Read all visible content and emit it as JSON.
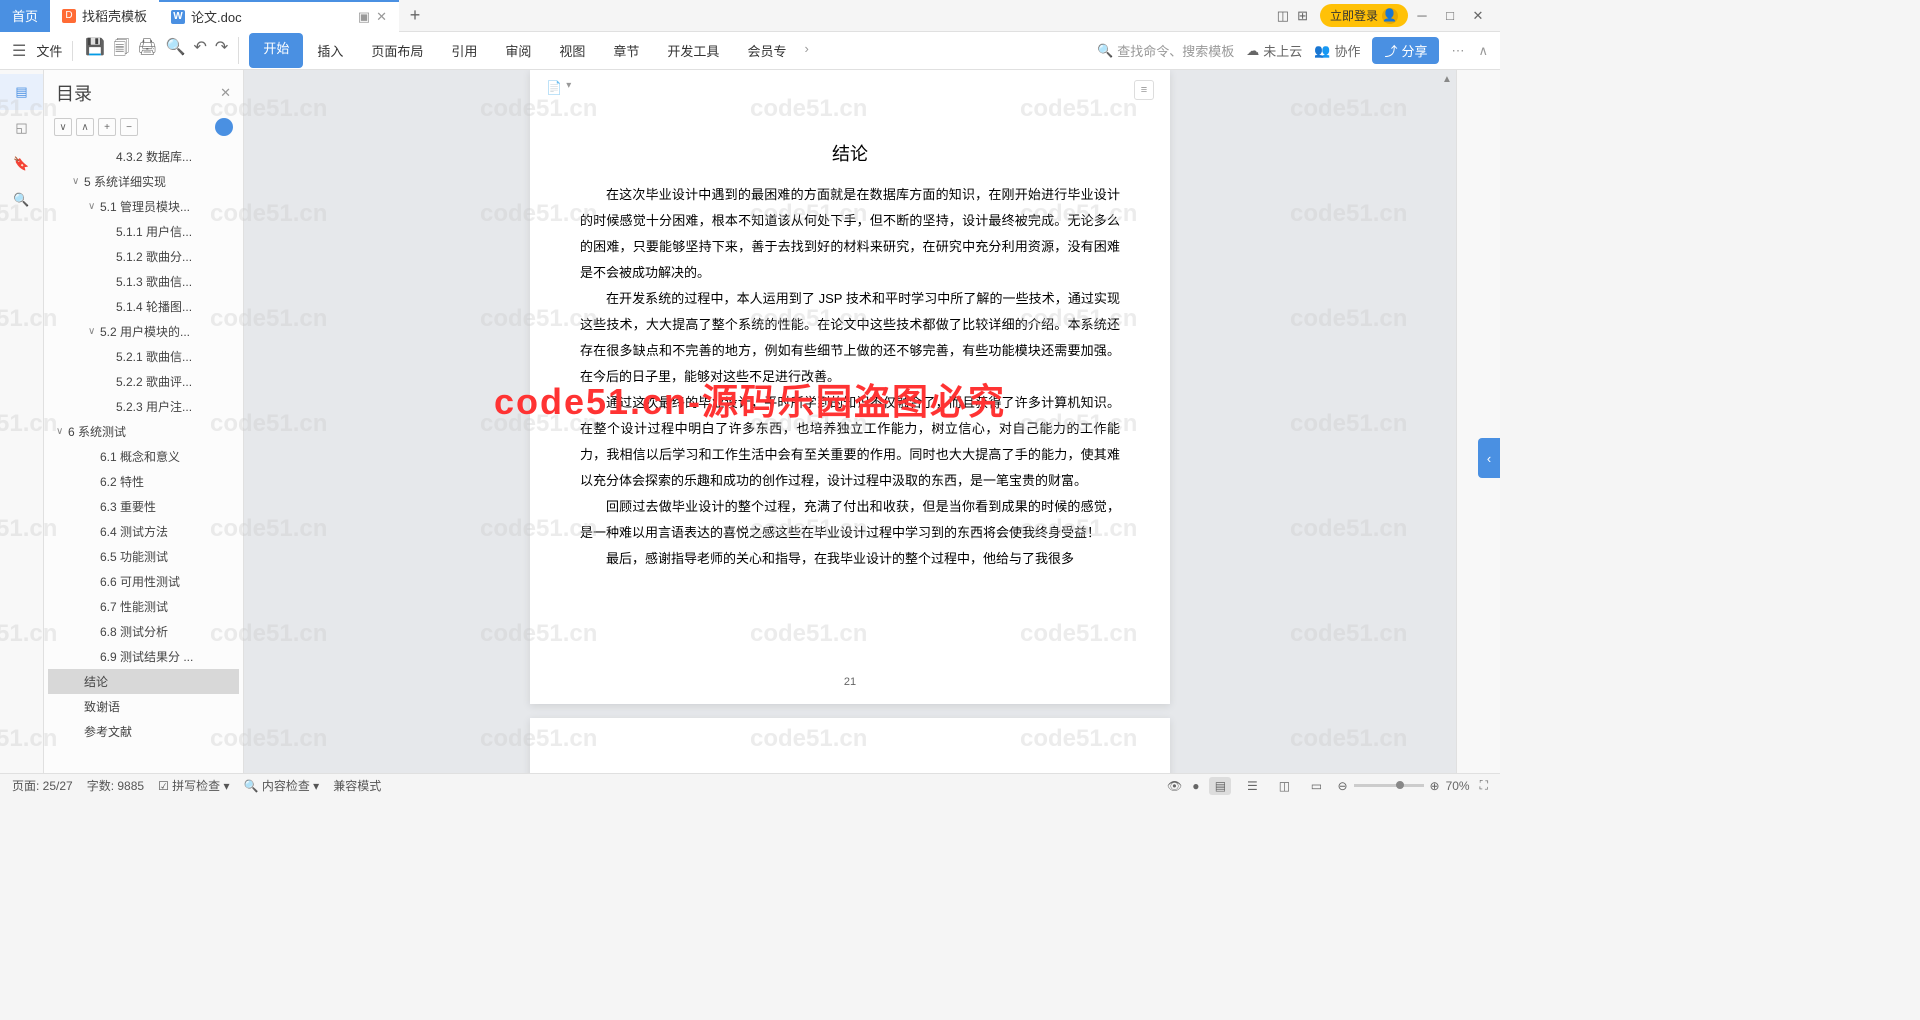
{
  "tabs": {
    "home": "首页",
    "t1": "找稻壳模板",
    "t2": "论文.doc"
  },
  "titlebar": {
    "login": "立即登录"
  },
  "toolbar": {
    "file": "文件",
    "menu": [
      "开始",
      "插入",
      "页面布局",
      "引用",
      "审阅",
      "视图",
      "章节",
      "开发工具",
      "会员专"
    ],
    "search": "查找命令、搜索模板",
    "cloud": "未上云",
    "collab": "协作",
    "share": "分享"
  },
  "sidebar": {
    "title": "目录",
    "items": [
      {
        "lvl": 4,
        "label": "4.3.2 数据库..."
      },
      {
        "lvl": 2,
        "label": "5 系统详细实现",
        "ch": "∨"
      },
      {
        "lvl": 3,
        "label": "5.1 管理员模块...",
        "ch": "∨"
      },
      {
        "lvl": 4,
        "label": "5.1.1 用户信..."
      },
      {
        "lvl": 4,
        "label": "5.1.2 歌曲分..."
      },
      {
        "lvl": 4,
        "label": "5.1.3 歌曲信..."
      },
      {
        "lvl": 4,
        "label": "5.1.4 轮播图..."
      },
      {
        "lvl": 3,
        "label": "5.2 用户模块的...",
        "ch": "∨"
      },
      {
        "lvl": 4,
        "label": "5.2.1 歌曲信..."
      },
      {
        "lvl": 4,
        "label": "5.2.2 歌曲评..."
      },
      {
        "lvl": 4,
        "label": "5.2.3 用户注..."
      },
      {
        "lvl": 1,
        "label": "6 系统测试",
        "ch": "∨"
      },
      {
        "lvl": 3,
        "label": "6.1 概念和意义"
      },
      {
        "lvl": 3,
        "label": "6.2 特性"
      },
      {
        "lvl": 3,
        "label": "6.3 重要性"
      },
      {
        "lvl": 3,
        "label": "6.4 测试方法"
      },
      {
        "lvl": 3,
        "label": "6.5 功能测试"
      },
      {
        "lvl": 3,
        "label": "6.6 可用性测试"
      },
      {
        "lvl": 3,
        "label": "6.7 性能测试"
      },
      {
        "lvl": 3,
        "label": "6.8 测试分析"
      },
      {
        "lvl": 3,
        "label": "6.9 测试结果分 ..."
      },
      {
        "lvl": 2,
        "label": "结论",
        "selected": true
      },
      {
        "lvl": 2,
        "label": "致谢语"
      },
      {
        "lvl": 2,
        "label": "参考文献"
      }
    ]
  },
  "doc": {
    "title": "结论",
    "p1": "在这次毕业设计中遇到的最困难的方面就是在数据库方面的知识，在刚开始进行毕业设计的时候感觉十分困难，根本不知道该从何处下手，但不断的坚持，设计最终被完成。无论多么的困难，只要能够坚持下来，善于去找到好的材料来研究，在研究中充分利用资源，没有困难是不会被成功解决的。",
    "p2": "在开发系统的过程中，本人运用到了 JSP 技术和平时学习中所了解的一些技术，通过实现这些技术，大大提高了整个系统的性能。在论文中这些技术都做了比较详细的介绍。本系统还存在很多缺点和不完善的地方，例如有些细节上做的还不够完善，有些功能模块还需要加强。在今后的日子里，能够对这些不足进行改善。",
    "p3": "通过这次最终的毕业设计，平时所学到的知识不仅融合了，而且获得了许多计算机知识。在整个设计过程中明白了许多东西，也培养独立工作能力，树立信心，对自己能力的工作能力，我相信以后学习和工作生活中会有至关重要的作用。同时也大大提高了手的能力，使其难以充分体会探索的乐趣和成功的创作过程，设计过程中汲取的东西，是一笔宝贵的财富。",
    "p4": "回顾过去做毕业设计的整个过程，充满了付出和收获，但是当你看到成果的时候的感觉，是一种难以用言语表达的喜悦之感这些在毕业设计过程中学习到的东西将会使我终身受益！",
    "p5": "最后，感谢指导老师的关心和指导，在我毕业设计的整个过程中，他给与了我很多",
    "pagenum": "21"
  },
  "watermark": {
    "gray": "code51.cn",
    "red": "code51.cn-源码乐园盗图必究"
  },
  "status": {
    "page": "页面: 25/27",
    "words": "字数: 9885",
    "spell": "拼写检查",
    "content": "内容检查",
    "compat": "兼容模式",
    "zoom": "70%"
  }
}
